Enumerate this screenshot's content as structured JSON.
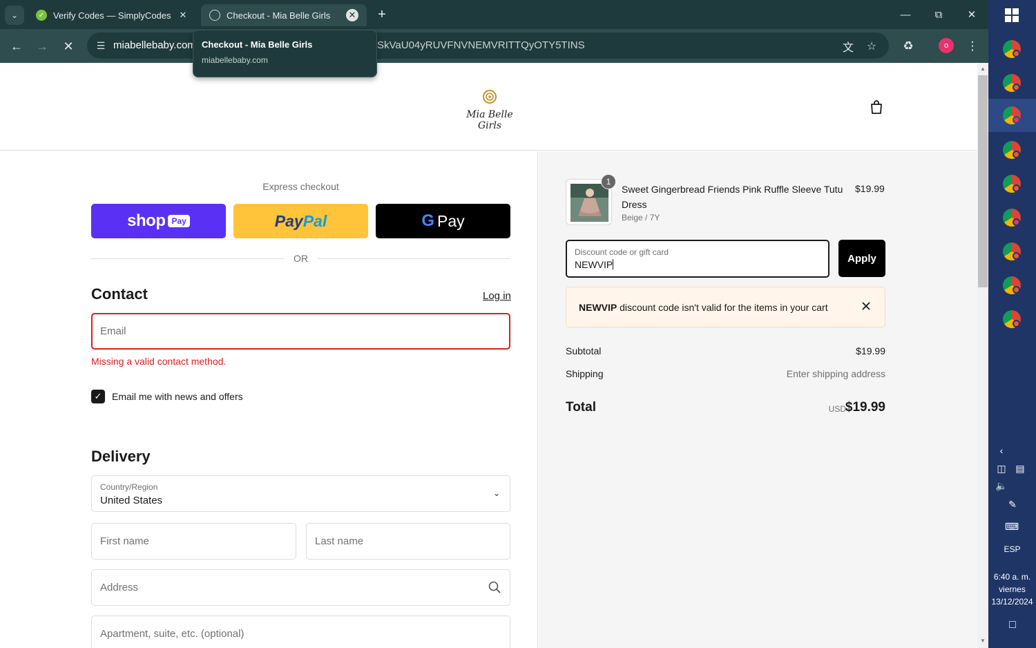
{
  "browser": {
    "tabs": [
      {
        "title": "Verify Codes — SimplyCodes",
        "active": false
      },
      {
        "title": "Checkout - Mia Belle Girls",
        "active": true
      }
    ],
    "tooltip": {
      "title": "Checkout - Mia Belle Girls",
      "domain": "miabellebaby.com"
    },
    "url_host": "miabellebaby.com",
    "url_rest": "SkVaU04yRUVFNVNEMVRITTQyOTY5TINS",
    "profile_initial": "o"
  },
  "store": {
    "logo_text": "Mia Belle Girls"
  },
  "checkout": {
    "express_label": "Express checkout",
    "shop_pay": {
      "word": "shop",
      "chip": "Pay"
    },
    "paypal": {
      "part1": "Pay",
      "part2": "Pal"
    },
    "gpay": {
      "g": "G",
      "word": "Pay"
    },
    "or_text": "OR",
    "contact": {
      "title": "Contact",
      "login": "Log in",
      "email_placeholder": "Email",
      "error": "Missing a valid contact method.",
      "newsletter_label": "Email me with news and offers",
      "newsletter_checked": true
    },
    "delivery": {
      "title": "Delivery",
      "country_label": "Country/Region",
      "country_value": "United States",
      "first_name_placeholder": "First name",
      "last_name_placeholder": "Last name",
      "address_placeholder": "Address",
      "apartment_placeholder": "Apartment, suite, etc. (optional)"
    }
  },
  "summary": {
    "item": {
      "quantity": "1",
      "name": "Sweet Gingerbread Friends Pink Ruffle Sleeve Tutu Dress",
      "variant": "Beige / 7Y",
      "price": "$19.99"
    },
    "discount": {
      "label": "Discount code or gift card",
      "value": "NEWVIP",
      "apply": "Apply",
      "notice_code": "NEWVIP",
      "notice_text": " discount code isn't valid for the items in your cart"
    },
    "subtotal_label": "Subtotal",
    "subtotal_value": "$19.99",
    "shipping_label": "Shipping",
    "shipping_value": "Enter shipping address",
    "total_label": "Total",
    "total_currency": "USD",
    "total_value": "$19.99"
  },
  "taskbar": {
    "language": "ESP",
    "time": "6:40 a. m.",
    "day": "viernes",
    "date": "13/12/2024"
  },
  "colors": {
    "shop_pay": "#5a31f4",
    "paypal": "#ffc439",
    "error": "#dd1d1d",
    "browser_frame": "#1f3a3c",
    "taskbar": "#1f3566"
  }
}
